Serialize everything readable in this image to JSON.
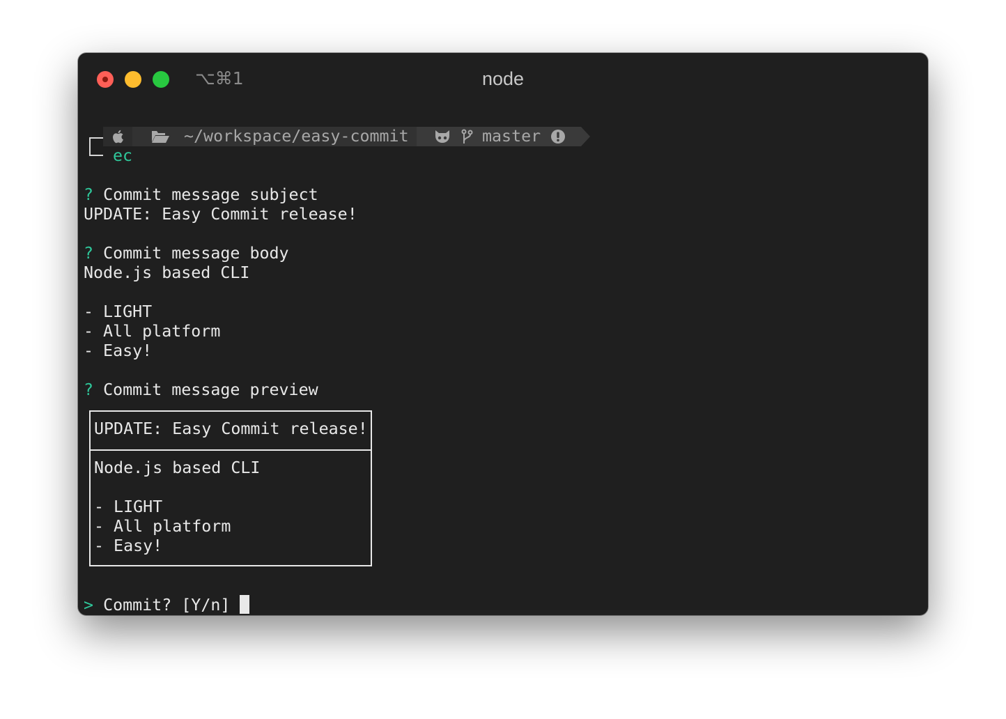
{
  "window": {
    "title": "node",
    "shortcut": "⌥⌘1"
  },
  "prompt": {
    "path": "~/workspace/easy-commit",
    "branch": "master",
    "command": "ec"
  },
  "questions": {
    "subject_label": "Commit message subject",
    "subject_value": "UPDATE: Easy Commit release!",
    "body_label": "Commit message body",
    "body_lines": [
      "Node.js based CLI",
      "",
      "- LIGHT",
      "- All platform",
      "- Easy!"
    ],
    "preview_label": "Commit message preview",
    "question_mark": "?"
  },
  "preview": {
    "subject": "UPDATE: Easy Commit release!",
    "body_lines": [
      "Node.js based CLI",
      "",
      "- LIGHT",
      "- All platform",
      "- Easy!"
    ]
  },
  "confirm": {
    "marker": ">",
    "text": "Commit? [Y/n]"
  },
  "colors": {
    "accent_green": "#2fc79a",
    "background": "#1f1f1f",
    "close": "#ff5f57",
    "minimize": "#febc2e",
    "maximize": "#28c840"
  },
  "icons": [
    "apple-icon",
    "folder-open-icon",
    "github-icon",
    "git-branch-icon",
    "alert-circle-icon"
  ]
}
